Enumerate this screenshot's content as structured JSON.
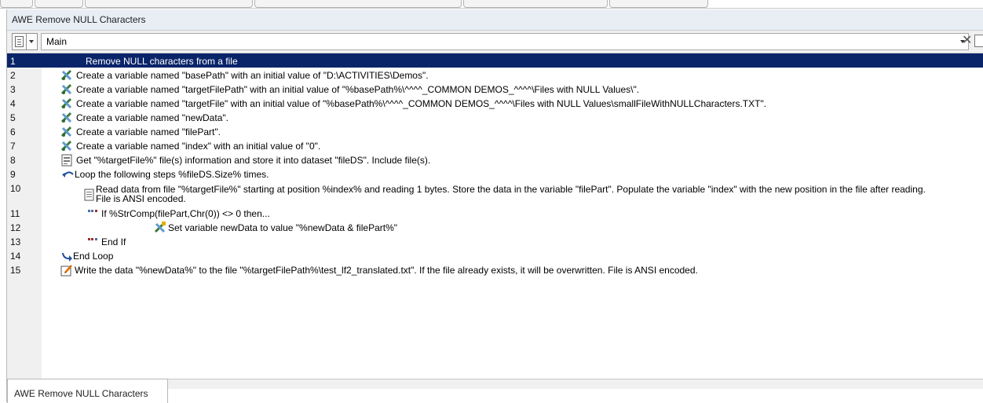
{
  "window": {
    "title": "AWE Remove NULL Characters"
  },
  "toolbar": {
    "main_combo_value": "Main"
  },
  "lines": [
    {
      "num": "1",
      "text": "Remove NULL characters from a file",
      "icon": "none"
    },
    {
      "num": "2",
      "text": "Create a variable named \"basePath\" with an initial value of \"D:\\ACTIVITIES\\Demos\".",
      "icon": "create-variable-icon"
    },
    {
      "num": "3",
      "text": "Create a variable named \"targetFilePath\" with an initial value of \"%basePath%\\^^^^_COMMON DEMOS_^^^^\\Files with NULL Values\\\".",
      "icon": "create-variable-icon"
    },
    {
      "num": "4",
      "text": "Create a variable named \"targetFile\" with an initial value of \"%basePath%\\^^^^_COMMON DEMOS_^^^^\\Files with NULL Values\\smallFileWithNULLCharacters.TXT\".",
      "icon": "create-variable-icon"
    },
    {
      "num": "5",
      "text": "Create a variable named \"newData\".",
      "icon": "create-variable-icon"
    },
    {
      "num": "6",
      "text": "Create a variable named \"filePart\".",
      "icon": "create-variable-icon"
    },
    {
      "num": "7",
      "text": "Create a variable named \"index\" with an initial value of \"0\".",
      "icon": "create-variable-icon"
    },
    {
      "num": "8",
      "text": "Get \"%targetFile%\" file(s) information and store it into dataset \"fileDS\". Include file(s).",
      "icon": "file-info-icon"
    },
    {
      "num": "9",
      "text": "Loop the following steps %fileDS.Size% times.",
      "icon": "loop-icon"
    },
    {
      "num": "10",
      "text": "Read data from file \"%targetFile%\" starting at position %index% and reading 1 bytes.  Store the data in the variable \"filePart\".  Populate the variable \"index\" with the new position in the file after reading.",
      "text2": "File is ANSI encoded.",
      "icon": "read-file-icon"
    },
    {
      "num": "11",
      "text": "If %StrComp(filePart,Chr(0)) <> 0 then...",
      "icon": "if-icon"
    },
    {
      "num": "12",
      "text": "Set variable newData to value \"%newData & filePart%\"",
      "icon": "set-variable-icon"
    },
    {
      "num": "13",
      "text": "End If",
      "icon": "end-if-icon"
    },
    {
      "num": "14",
      "text": "End Loop",
      "icon": "end-loop-icon"
    },
    {
      "num": "15",
      "text": "Write the data \"%newData%\" to the file \"%targetFilePath%\\test_lf2_translated.txt\".  If the file already exists, it will be overwritten.  File is ANSI encoded.",
      "icon": "write-file-icon"
    }
  ],
  "bottom_tab": {
    "label": "AWE Remove NULL Characters"
  },
  "colors": {
    "selected_row": "#0a246a",
    "gutter": "#f0f0f0",
    "title_bar": "#e9eef5"
  }
}
